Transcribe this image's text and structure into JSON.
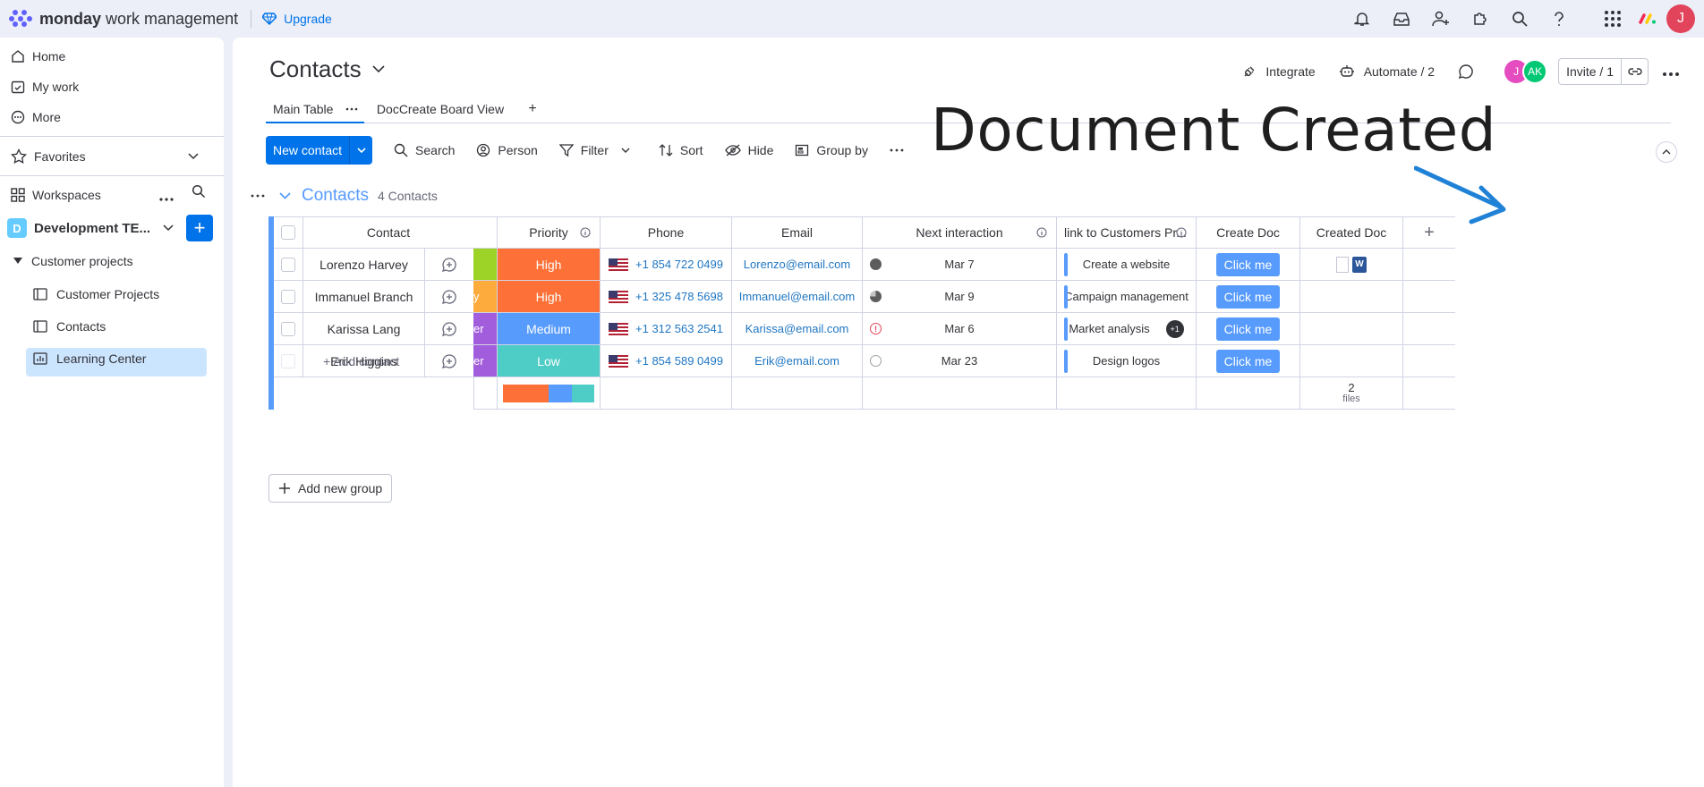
{
  "topbar": {
    "brand_strong": "monday",
    "brand_light": "work management",
    "upgrade_label": "Upgrade",
    "avatar_initial": "J"
  },
  "sidebar": {
    "home": "Home",
    "my_work": "My work",
    "more": "More",
    "favorites": "Favorites",
    "workspaces": "Workspaces",
    "workspace_badge": "D",
    "workspace_name": "Development TE...",
    "folder": "Customer projects",
    "items": [
      {
        "label": "Customer Projects"
      },
      {
        "label": "Contacts"
      },
      {
        "label": "Learning Center"
      }
    ]
  },
  "header": {
    "title": "Contacts",
    "integrate": "Integrate",
    "automate": "Automate / 2",
    "avatar1": "J",
    "avatar2": "AK",
    "invite": "Invite / 1"
  },
  "tabs": {
    "main_table": "Main Table",
    "doccreate": "DocCreate Board View",
    "add": "+"
  },
  "annotation": "Document Created",
  "toolbar": {
    "new_contact": "New contact",
    "search": "Search",
    "person": "Person",
    "filter": "Filter",
    "sort": "Sort",
    "hide": "Hide",
    "group_by": "Group by"
  },
  "group": {
    "name": "Contacts",
    "count": "4 Contacts"
  },
  "table": {
    "headers": {
      "contact": "Contact",
      "priority": "Priority",
      "phone": "Phone",
      "email": "Email",
      "next": "Next interaction",
      "link": "link to Customers Pr...",
      "create_doc": "Create Doc",
      "created_doc": "Created Doc",
      "add": "+"
    },
    "rows": [
      {
        "contact": "Lorenzo Harvey",
        "tag": "",
        "priority": "High",
        "phone": "+1 854 722 0499",
        "email": "Lorenzo@email.com",
        "next": "Mar 7",
        "link": "Create a website",
        "extra": "",
        "button": "Click me",
        "doc_icon": "W"
      },
      {
        "contact": "Immanuel Branch",
        "tag": "y",
        "priority": "High",
        "phone": "+1 325 478 5698",
        "email": "Immanuel@email.com",
        "next": "Mar 9",
        "link": "Campaign management",
        "extra": "",
        "button": "Click me"
      },
      {
        "contact": "Karissa Lang",
        "tag": "er",
        "priority": "Medium",
        "phone": "+1 312 563 2541",
        "email": "Karissa@email.com",
        "next": "Mar 6",
        "link": "Market analysis",
        "extra": "+1",
        "button": "Click me"
      },
      {
        "contact": "Erik Higgins",
        "tag": "er",
        "priority": "Low",
        "phone": "+1 854 589 0499",
        "email": "Erik@email.com",
        "next": "Mar 23",
        "link": "Design logos",
        "extra": "",
        "button": "Click me"
      }
    ],
    "add_row": "+ Add contact",
    "summary_files_count": "2",
    "summary_files_label": "files",
    "priority_distribution": [
      {
        "label": "High",
        "fraction": 0.5
      },
      {
        "label": "Medium",
        "fraction": 0.25
      },
      {
        "label": "Low",
        "fraction": 0.25
      }
    ]
  },
  "colors": {
    "high": "#fd7037",
    "medium": "#579bfc",
    "low": "#4eccc6",
    "tag_green": "#9cd326",
    "tag_orange": "#fdab3d",
    "tag_purple": "#a25ddc",
    "accent": "#0073ea"
  },
  "add_group": "Add new group"
}
